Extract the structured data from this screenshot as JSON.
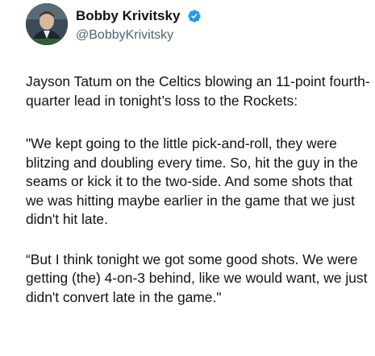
{
  "author": {
    "display_name": "Bobby Krivitsky",
    "handle": "@BobbyKrivitsky",
    "verified": true,
    "verified_color": "#1d9bf0"
  },
  "tweet": {
    "paragraphs": [
      "Jayson Tatum on the Celtics blowing an 11-point fourth-quarter lead in tonight’s loss to the Rockets:",
      "\"We kept going to the little pick-and-roll, they were blitzing and doubling every time. So, hit the guy in the seams or kick it to the two-side. And some shots that we was hitting maybe earlier in the game that we just didn't hit late.",
      "“But I think tonight we got some good shots. We were getting (the) 4-on-3 behind, like we would want, we just didn't convert late in the game.\""
    ]
  },
  "icons": {
    "avatar": "profile-avatar",
    "verified": "verified-badge-icon"
  }
}
